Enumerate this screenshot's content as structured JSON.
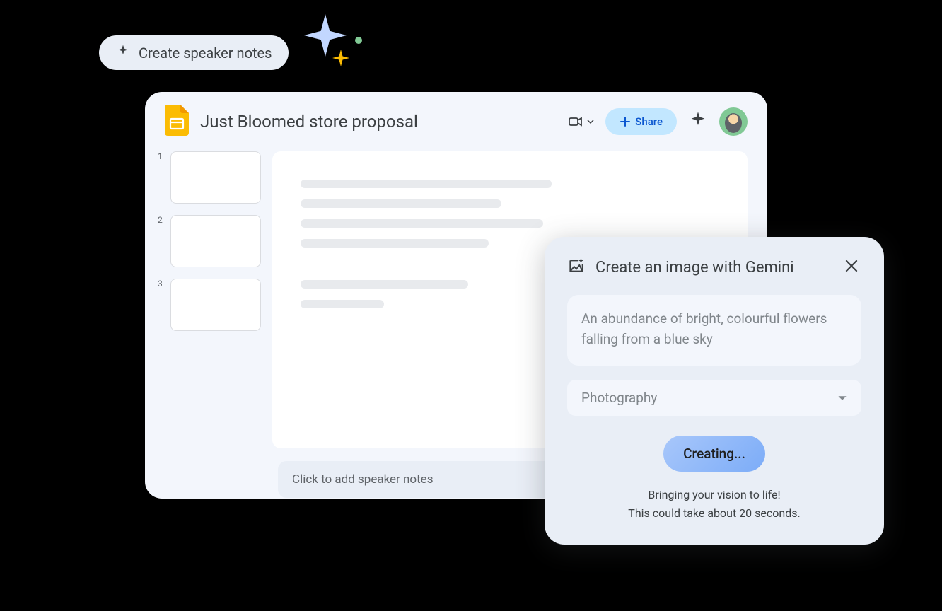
{
  "chip": {
    "label": "Create speaker notes"
  },
  "doc": {
    "title": "Just Bloomed store proposal"
  },
  "header": {
    "share_label": "Share"
  },
  "thumbs": {
    "n1": "1",
    "n2": "2",
    "n3": "3"
  },
  "speaker_notes": {
    "placeholder": "Click to add speaker notes"
  },
  "gemini": {
    "title": "Create an image with Gemini",
    "prompt": "An abundance of bright, colourful flowers falling from a blue sky",
    "style": "Photography",
    "creating_label": "Creating...",
    "status_line1": "Bringing your vision to life!",
    "status_line2": "This could take about 20 seconds."
  }
}
